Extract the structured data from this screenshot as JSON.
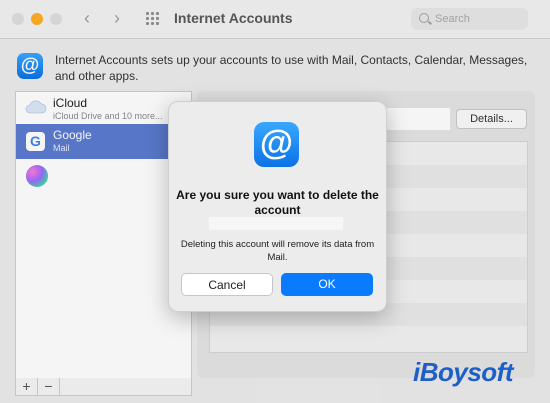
{
  "window": {
    "title": "Internet Accounts",
    "search_placeholder": "Search"
  },
  "header": {
    "description": "Internet Accounts sets up your accounts to use with Mail, Contacts, Calendar, Messages, and other apps.",
    "icon": "at-sign-icon"
  },
  "accounts": [
    {
      "label": "iCloud",
      "sub": "iCloud Drive and 10 more...",
      "icon": "icloud-icon"
    },
    {
      "label": "Google",
      "sub": "Mail",
      "icon": "google-icon",
      "selected": true
    },
    {
      "label": "",
      "sub": "",
      "icon": "game-center-icon"
    }
  ],
  "list_controls": {
    "add": "+",
    "remove": "−"
  },
  "details_button": "Details...",
  "dialog": {
    "title": "Are you sure you want to delete the account",
    "message": "Deleting this account will remove its data from Mail.",
    "cancel_label": "Cancel",
    "ok_label": "OK"
  },
  "watermark": "iBoysoft",
  "colors": {
    "accent": "#0a7bff",
    "selection": "#5b7bd0",
    "watermark": "#1d5fc6"
  }
}
